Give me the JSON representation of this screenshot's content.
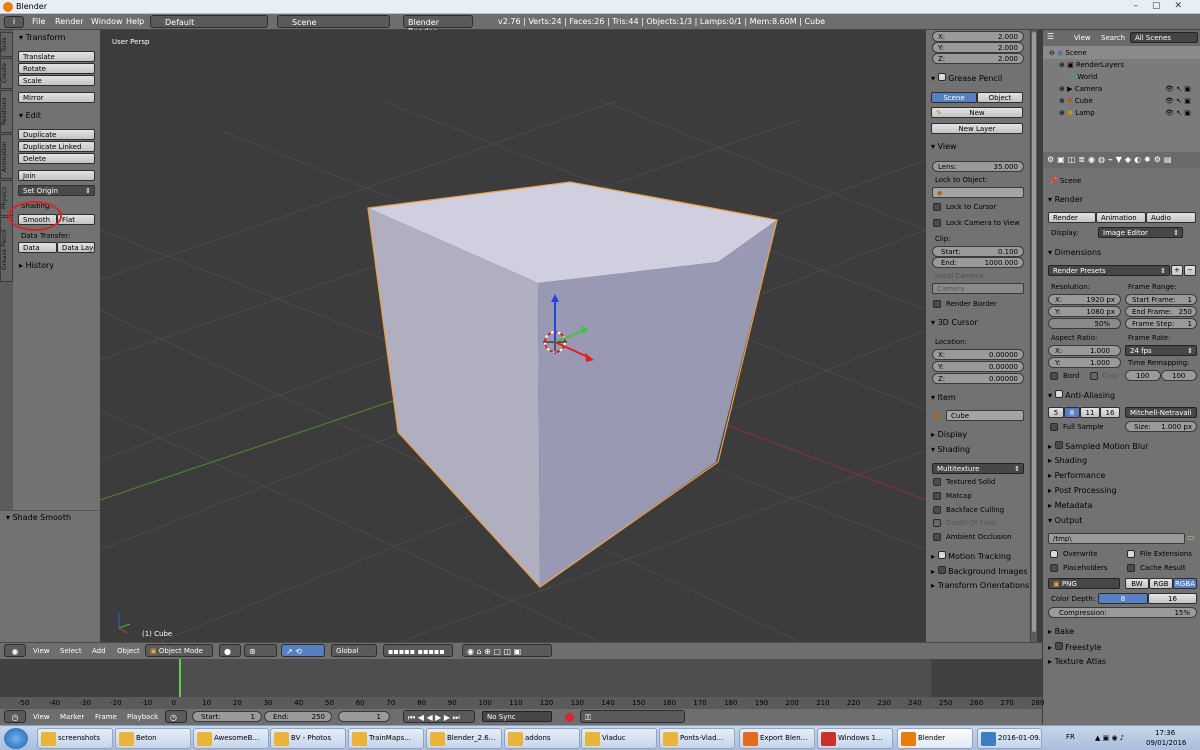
{
  "window": {
    "title": "Blender"
  },
  "menu": {
    "file": "File",
    "render": "Render",
    "window": "Window",
    "help": "Help",
    "layout": "Default",
    "scene": "Scene",
    "engine": "Blender Render",
    "stats": "v2.76 | Verts:24 | Faces:26 | Tris:44 | Objects:1/3 | Lamps:0/1 | Mem:8.60M | Cube"
  },
  "tool_tabs": [
    "Tools",
    "Create",
    "Relations",
    "Animation",
    "Physics",
    "Grease Pencil"
  ],
  "tools": {
    "transform_header": "Transform",
    "translate": "Translate",
    "rotate": "Rotate",
    "scale": "Scale",
    "mirror": "Mirror",
    "edit_header": "Edit",
    "duplicate": "Duplicate",
    "duplicate_linked": "Duplicate Linked",
    "delete": "Delete",
    "join": "Join",
    "set_origin": "Set Origin",
    "shading_label": "Shading:",
    "smooth": "Smooth",
    "flat": "Flat",
    "data_transfer_label": "Data Transfer:",
    "data": "Data",
    "data_layout": "Data Layo",
    "history": "History"
  },
  "operator": {
    "title": "Shade Smooth"
  },
  "viewport": {
    "persp_label": "User Persp",
    "object_label": "(1) Cube"
  },
  "props": {
    "scale": [
      {
        "axis": "X:",
        "value": "2.000"
      },
      {
        "axis": "Y:",
        "value": "2.000"
      },
      {
        "axis": "Z:",
        "value": "2.000"
      }
    ],
    "grease_pencil": "Grease Pencil",
    "gp_scene": "Scene",
    "gp_object": "Object",
    "gp_new": "New",
    "gp_new_layer": "New Layer",
    "view_header": "View",
    "lens_label": "Lens:",
    "lens_value": "35.000",
    "lock_to_object": "Lock to Object:",
    "lock_to_cursor": "Lock to Cursor",
    "lock_camera_to_view": "Lock Camera to View",
    "clip_label": "Clip:",
    "clip_start_label": "Start:",
    "clip_start": "0.100",
    "clip_end_label": "End:",
    "clip_end": "1000.000",
    "local_camera": "Local Camera:",
    "camera": "Camera",
    "render_border": "Render Border",
    "cursor_header": "3D Cursor",
    "location_label": "Location:",
    "location": [
      {
        "axis": "X:",
        "value": "0.00000"
      },
      {
        "axis": "Y:",
        "value": "0.00000"
      },
      {
        "axis": "Z:",
        "value": "0.00000"
      }
    ],
    "item_header": "Item",
    "item_name": "Cube",
    "display_header": "Display",
    "shading_header": "Shading",
    "multitexture": "Multitexture",
    "textured_solid": "Textured Solid",
    "matcap": "Matcap",
    "backface_culling": "Backface Culling",
    "depth_of_field": "Depth Of Field",
    "ambient_occlusion": "Ambient Occlusion",
    "motion_tracking": "Motion Tracking",
    "background_images": "Background Images",
    "transform_orientations": "Transform Orientations"
  },
  "outliner": {
    "view": "View",
    "search": "Search",
    "all_scenes": "All Scenes",
    "items": [
      "Scene",
      "RenderLayers",
      "World",
      "Camera",
      "Cube",
      "Lamp"
    ]
  },
  "render": {
    "scene": "Scene",
    "render_header": "Render",
    "render_btn": "Render",
    "animation_btn": "Animation",
    "audio_btn": "Audio",
    "display_label": "Display:",
    "display_value": "Image Editor",
    "dimensions": "Dimensions",
    "presets": "Render Presets",
    "resolution": "Resolution:",
    "res_x_label": "X:",
    "res_x": "1920 px",
    "res_y_label": "Y:",
    "res_y": "1080 px",
    "res_pct": "50%",
    "frame_range": "Frame Range:",
    "start_frame_label": "Start Frame:",
    "start_frame": "1",
    "end_frame_label": "End Frame:",
    "end_frame": "250",
    "frame_step_label": "Frame Step:",
    "frame_step": "1",
    "aspect_ratio": "Aspect Ratio:",
    "asp_x_label": "X:",
    "asp_x": "1.000",
    "asp_y_label": "Y:",
    "asp_y": "1.000",
    "frame_rate": "Frame Rate:",
    "fps": "24 fps",
    "time_remap": "Time Remapping:",
    "old": "100",
    "new": "100",
    "bord": "Bord",
    "crop": "Crop",
    "anti_aliasing": "Anti-Aliasing",
    "aa_levels": [
      "5",
      "8",
      "11",
      "16"
    ],
    "filter": "Mitchell-Netravali",
    "full_sample": "Full Sample",
    "size_label": "Size:",
    "size_value": "1.000 px",
    "collapsed": [
      "Sampled Motion Blur",
      "Shading",
      "Performance",
      "Post Processing",
      "Metadata"
    ],
    "output": "Output",
    "output_path": "/tmp\\",
    "overwrite": "Overwrite",
    "file_extensions": "File Extensions",
    "placeholders": "Placeholders",
    "cache_result": "Cache Result",
    "format": "PNG",
    "bw": "BW",
    "rgb": "RGB",
    "rgba": "RGBA",
    "color_depth": "Color Depth:",
    "depth8": "8",
    "depth16": "16",
    "compression_label": "Compression:",
    "compression": "15%",
    "bake": "Bake",
    "freestyle": "Freestyle",
    "texture_atlas": "Texture Atlas"
  },
  "view_header": {
    "view": "View",
    "select": "Select",
    "add": "Add",
    "object": "Object",
    "mode": "Object Mode",
    "orientation": "Global"
  },
  "timeline": {
    "ticks": [
      "-50",
      "-40",
      "-30",
      "-20",
      "-10",
      "0",
      "10",
      "20",
      "30",
      "40",
      "50",
      "60",
      "70",
      "80",
      "90",
      "100",
      "110",
      "120",
      "130",
      "140",
      "150",
      "160",
      "170",
      "180",
      "190",
      "200",
      "210",
      "220",
      "230",
      "240",
      "250",
      "260",
      "270",
      "280"
    ],
    "view": "View",
    "marker": "Marker",
    "frame": "Frame",
    "playback": "Playback",
    "start_label": "Start:",
    "start": "1",
    "end_label": "End:",
    "end": "250",
    "current": "1",
    "sync": "No Sync"
  },
  "taskbar": {
    "items": [
      "screenshots",
      "Beton",
      "AwesomeB...",
      "BV - Photos",
      "TrainMaps...",
      "Blender_2.6...",
      "addons",
      "Viaduc",
      "Ponts-Viad...",
      "Export Blen...",
      "Windows 1...",
      "Blender",
      "2016-01-09..."
    ],
    "lang": "FR",
    "time": "17:36",
    "date": "09/01/2016"
  }
}
